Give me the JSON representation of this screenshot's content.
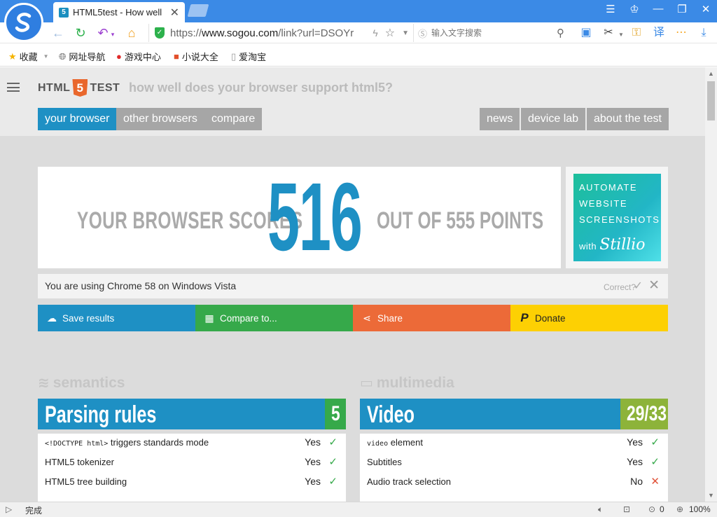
{
  "browser": {
    "tab_title": "HTML5test - How well",
    "tab_favicon": "5",
    "url_prefix": "https://",
    "url_domain": "www.sogou.com",
    "url_rest": "/link?url=DSOYr",
    "search_placeholder": "输入文字搜索",
    "status_text": "完成",
    "zoom": "100%",
    "download_count": "0"
  },
  "bookmarks": [
    {
      "icon": "star-icon",
      "label": "收藏"
    },
    {
      "icon": "globe-icon",
      "label": "网址导航"
    },
    {
      "icon": "game-icon",
      "label": "游戏中心"
    },
    {
      "icon": "book-icon",
      "label": "小说大全"
    },
    {
      "icon": "page-icon",
      "label": "爱淘宝"
    }
  ],
  "site": {
    "brand_left": "HTML",
    "brand_badge": "5",
    "brand_right": "TEST",
    "tagline": "how well does your browser support html5?",
    "nav_left": [
      "your browser",
      "other browsers",
      "compare"
    ],
    "nav_right": [
      "news",
      "device lab",
      "about the test"
    ]
  },
  "score": {
    "prefix": "YOUR BROWSER SCORES",
    "value": "516",
    "suffix": "OUT OF 555 POINTS"
  },
  "ad": {
    "line1": "AUTOMATE",
    "line2": "WEBSITE",
    "line3": "SCREENSHOTS",
    "with": "with",
    "brand": "Stillio"
  },
  "using": {
    "text": "You are using Chrome 58 on Windows Vista",
    "correct": "Correct?"
  },
  "actions": [
    {
      "label": "Save results",
      "icon": "cloud-upload-icon",
      "color": "#1e90c4"
    },
    {
      "label": "Compare to...",
      "icon": "grid-icon",
      "color": "#36a94a"
    },
    {
      "label": "Share",
      "icon": "share-icon",
      "color": "#ec6a38"
    },
    {
      "label": "Donate",
      "icon": "paypal-icon",
      "color": "#fdd003"
    }
  ],
  "sections": {
    "left": {
      "title": "semantics",
      "card_title": "Parsing rules",
      "card_score": "5",
      "rows": [
        {
          "code": "<!DOCTYPE html>",
          "label": " triggers standards mode",
          "value": "Yes",
          "ok": true
        },
        {
          "code": "",
          "label": "HTML5 tokenizer",
          "value": "Yes",
          "ok": true
        },
        {
          "code": "",
          "label": "HTML5 tree building",
          "value": "Yes",
          "ok": true
        }
      ]
    },
    "right": {
      "title": "multimedia",
      "card_title": "Video",
      "card_score": "29/33",
      "rows": [
        {
          "code": "video",
          "label": " element",
          "value": "Yes",
          "ok": true
        },
        {
          "code": "",
          "label": "Subtitles",
          "value": "Yes",
          "ok": true
        },
        {
          "code": "",
          "label": "Audio track selection",
          "value": "No",
          "ok": false
        }
      ]
    }
  },
  "colors": {
    "accent_blue": "#1e90c4",
    "accent_green": "#36a94a",
    "accent_orange": "#ec6a38",
    "accent_yellow": "#fdd003",
    "chrome_blue": "#3b8ae6"
  }
}
